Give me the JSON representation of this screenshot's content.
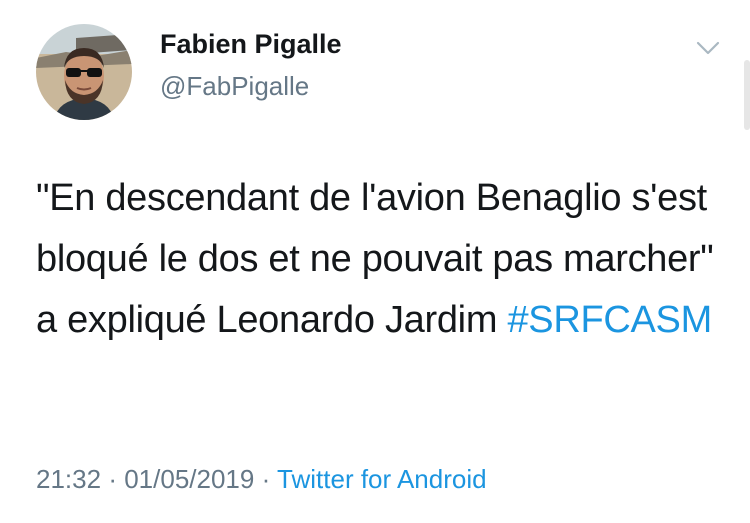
{
  "author": {
    "display_name": "Fabien Pigalle",
    "handle": "@FabPigalle"
  },
  "tweet": {
    "text": "\"En descendant de l'avion Benaglio s'est bloqué le dos et ne pouvait pas marcher\" a expliqué Leonardo Jardim ",
    "hashtag": "#SRFCASM",
    "time": "21:32",
    "separator": "·",
    "date": "01/05/2019",
    "source": "Twitter for Android"
  },
  "icons": {
    "menu": "chevron-down-icon"
  },
  "colors": {
    "link": "#1b95e0",
    "secondary_text": "#657786",
    "primary_text": "#14171a"
  }
}
